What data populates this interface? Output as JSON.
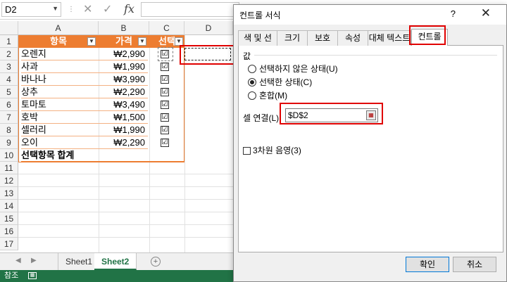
{
  "formula_bar": {
    "name_box": "D2",
    "cancel_icon": "✕",
    "enter_icon": "✓",
    "fx_label": "fx",
    "formula": ""
  },
  "columns": [
    "A",
    "B",
    "C",
    "D"
  ],
  "rows": [
    "1",
    "2",
    "3",
    "4",
    "5",
    "6",
    "7",
    "8",
    "9",
    "10",
    "11",
    "12",
    "13",
    "14",
    "15",
    "16",
    "17"
  ],
  "table": {
    "headers": [
      "항목",
      "가격",
      "선택"
    ],
    "items": [
      {
        "name": "오렌지",
        "price": "₩2,990",
        "checked": "☑"
      },
      {
        "name": "사과",
        "price": "₩1,990",
        "checked": "☑"
      },
      {
        "name": "바나나",
        "price": "₩3,990",
        "checked": "☑"
      },
      {
        "name": "상추",
        "price": "₩2,290",
        "checked": "☑"
      },
      {
        "name": "토마토",
        "price": "₩3,490",
        "checked": "☑"
      },
      {
        "name": "호박",
        "price": "₩1,500",
        "checked": "☑"
      },
      {
        "name": "셀러리",
        "price": "₩1,990",
        "checked": "☑"
      },
      {
        "name": "오이",
        "price": "₩2,290",
        "checked": "☑"
      }
    ],
    "total_label": "선택항목 합계"
  },
  "sheets": {
    "tabs": [
      "Sheet1",
      "Sheet2"
    ],
    "active": "Sheet2",
    "add_icon": "+"
  },
  "status_bar": {
    "text": "참조"
  },
  "dialog": {
    "title": "컨트롤 서식",
    "help": "?",
    "close": "✕",
    "tabs": [
      "색 및 선",
      "크기",
      "보호",
      "속성",
      "대체 텍스트",
      "컨트롤"
    ],
    "active_tab": "컨트롤",
    "value_group_label": "값",
    "radio_options": [
      "선택하지 않은 상태(U)",
      "선택한 상태(C)",
      "혼합(M)"
    ],
    "selected_radio": "선택한 상태(C)",
    "cell_link_label": "셀 연결(L):",
    "cell_link_value": "$D$2",
    "shading_label": "3차원 음영(3)",
    "ok_label": "확인",
    "cancel_label": "취소"
  },
  "colors": {
    "table_header": "#ed7d31",
    "highlight": "#e00000",
    "status_bar": "#217346"
  }
}
